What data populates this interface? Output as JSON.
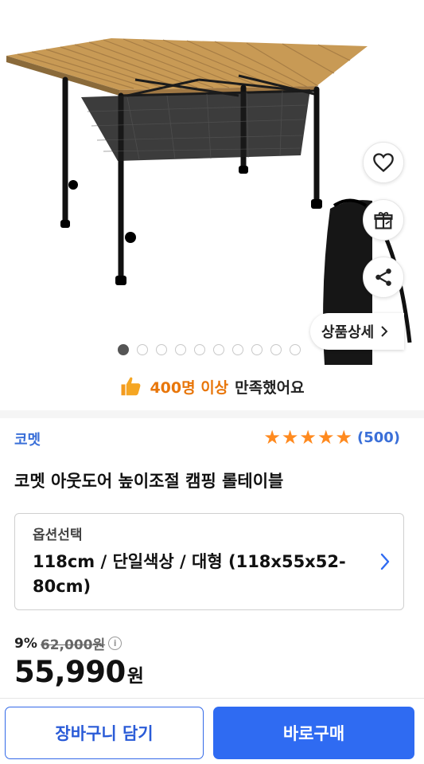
{
  "hero": {
    "detail_label": "상품상세",
    "dots_total": 10,
    "dots_active": 0
  },
  "satisfaction": {
    "highlight": "400명 이상",
    "rest": "만족했어요"
  },
  "product": {
    "brand": "코멧",
    "rating": 5,
    "review_count": "(500)",
    "title": "코멧 아웃도어 높이조절 캠핑 롤테이블"
  },
  "option": {
    "label": "옵션선택",
    "value": "118cm / 단일색상 / 대형 (118x55x52-80cm)"
  },
  "price": {
    "discount_rate": "9%",
    "original": "62,000원",
    "current": "55,990",
    "unit": "원"
  },
  "buttons": {
    "cart": "장바구니 담기",
    "buy": "바로구매"
  },
  "colors": {
    "accent_blue": "#2f6bf2",
    "brand_blue": "#3a6fd8",
    "star_orange": "#ff8a1f",
    "highlight_orange": "#e8760a"
  }
}
